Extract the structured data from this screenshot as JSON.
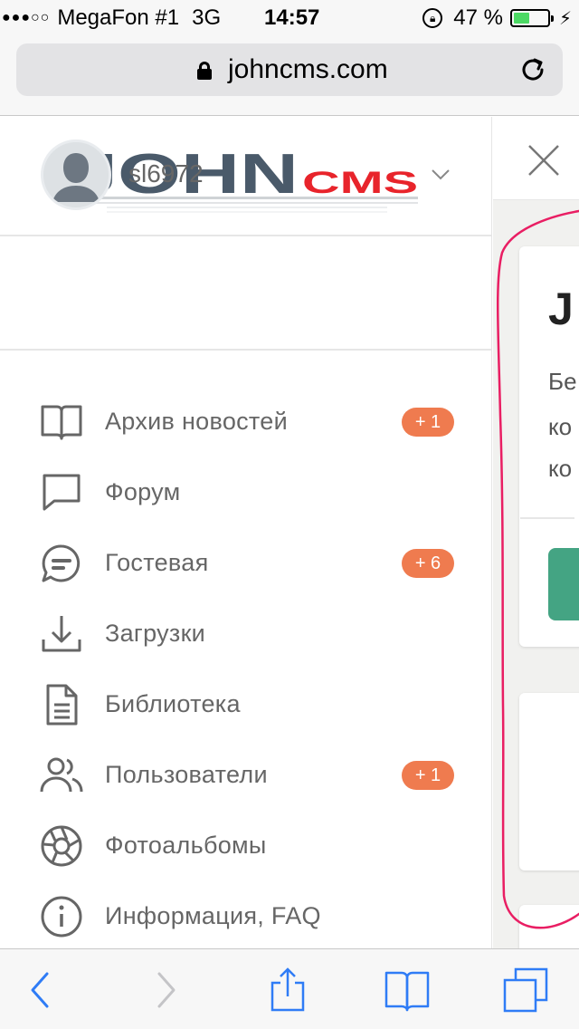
{
  "status_bar": {
    "signal": "●●●○○",
    "carrier": "MegaFon #1",
    "network": "3G",
    "time": "14:57",
    "battery": "47 %",
    "battery_level": 0.47
  },
  "browser": {
    "url": "johncms.com"
  },
  "sidebar": {
    "logo": {
      "main": "JOHN",
      "sub": "CMS"
    },
    "user": {
      "username": "sl6972"
    },
    "menu": [
      {
        "label": "Архив новостей",
        "icon": "book-icon",
        "badge": "+ 1"
      },
      {
        "label": "Форум",
        "icon": "chat-bubble-icon",
        "badge": ""
      },
      {
        "label": "Гостевая",
        "icon": "guestbook-chat-icon",
        "badge": "+ 6"
      },
      {
        "label": "Загрузки",
        "icon": "download-icon",
        "badge": ""
      },
      {
        "label": "Библиотека",
        "icon": "document-icon",
        "badge": ""
      },
      {
        "label": "Пользователи",
        "icon": "users-icon",
        "badge": "+ 1"
      },
      {
        "label": "Фотоальбомы",
        "icon": "camera-aperture-icon",
        "badge": ""
      },
      {
        "label": "Информация, FAQ",
        "icon": "info-icon",
        "badge": ""
      }
    ]
  },
  "content_peek": {
    "title_fragment": "J",
    "lines": [
      "Бе",
      "ко",
      "ко"
    ]
  },
  "colors": {
    "badge": "#ef7b4f",
    "accent_button": "#44a483",
    "logo_dark": "#4a5a6a",
    "logo_red": "#e8242b",
    "ios_blue": "#2f7cf6",
    "annotation": "#e91e63"
  }
}
